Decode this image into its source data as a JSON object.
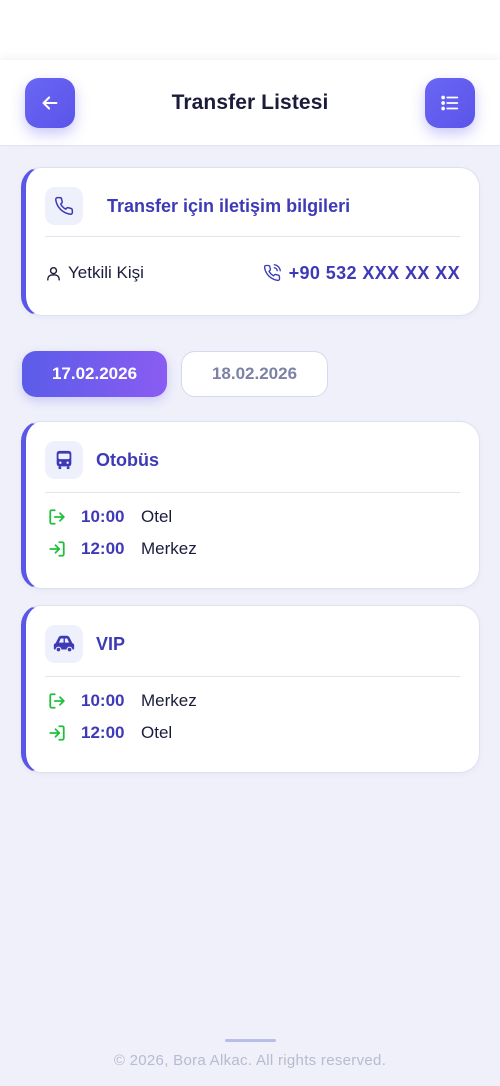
{
  "header": {
    "title": "Transfer Listesi",
    "back_icon": "arrow-left-icon",
    "menu_icon": "list-icon"
  },
  "contact": {
    "title": "Transfer için iletişim bilgileri",
    "person_label": "Yetkili Kişi",
    "phone": "+90 532 XXX XX XX",
    "icons": [
      "phone-icon",
      "user-icon",
      "phone-call-icon"
    ]
  },
  "dates": [
    {
      "label": "17.02.2026",
      "selected": true
    },
    {
      "label": "18.02.2026",
      "selected": false
    }
  ],
  "transfers": [
    {
      "type": "Otobüs",
      "icon": "bus-icon",
      "stops": [
        {
          "direction": "departure",
          "time": "10:00",
          "place": "Otel"
        },
        {
          "direction": "arrival",
          "time": "12:00",
          "place": "Merkez"
        }
      ]
    },
    {
      "type": "VIP",
      "icon": "car-icon",
      "stops": [
        {
          "direction": "departure",
          "time": "10:00",
          "place": "Merkez"
        },
        {
          "direction": "arrival",
          "time": "12:00",
          "place": "Otel"
        }
      ]
    }
  ],
  "footer": {
    "copyright": "© 2026, Bora Alkac. All rights reserved."
  },
  "colors": {
    "accent": "#5b57e6",
    "accent_text": "#3e3ab6",
    "background": "#eff0fa",
    "stop_icon_green": "#21c03c",
    "date_gradient_start": "#5b5ce9",
    "date_gradient_end": "#8a5cf2"
  }
}
